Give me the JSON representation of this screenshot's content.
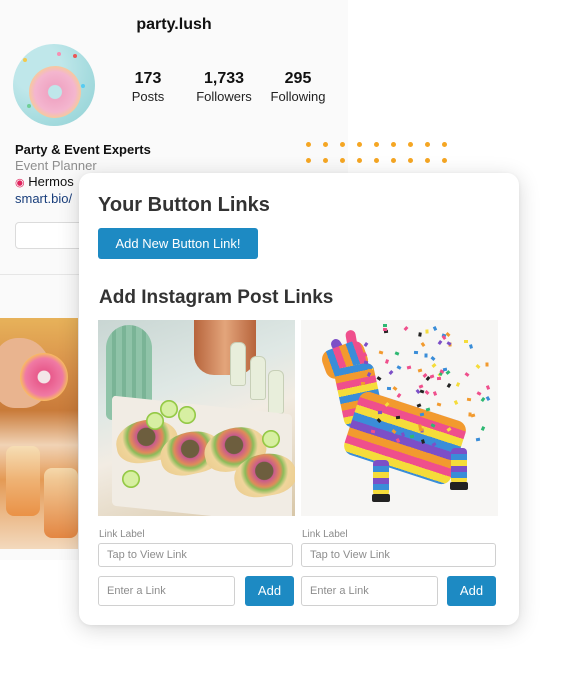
{
  "profile": {
    "username": "party.lush",
    "stats": [
      {
        "value": "173",
        "label": "Posts"
      },
      {
        "value": "1,733",
        "label": "Followers"
      },
      {
        "value": "295",
        "label": "Following"
      }
    ],
    "bio_name": "Party & Event Experts",
    "bio_category": "Event Planner",
    "bio_location": "Hermos",
    "bio_link": "smart.bio/",
    "location_icon": "pin-icon"
  },
  "card": {
    "title": "Your Button Links",
    "add_button_label": "Add New Button Link!",
    "posts_title": "Add Instagram Post Links",
    "posts": [
      {
        "image": "tacos-photo",
        "link_label_caption": "Link Label",
        "label_placeholder": "Tap to View Link",
        "link_placeholder": "Enter a Link",
        "add_label": "Add"
      },
      {
        "image": "pinata-photo",
        "link_label_caption": "Link Label",
        "label_placeholder": "Tap to View Link",
        "link_placeholder": "Enter a Link",
        "add_label": "Add"
      }
    ]
  },
  "colors": {
    "accent": "#1d8ac3",
    "dots": "#f5a623"
  }
}
